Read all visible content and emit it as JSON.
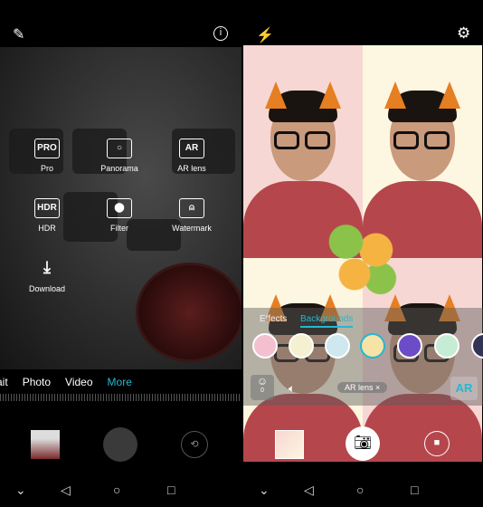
{
  "left": {
    "top_bar": {
      "edit_icon": "pencil-icon",
      "info_icon": "info-icon"
    },
    "modes": [
      {
        "label": "Pro",
        "icon": "PRO"
      },
      {
        "label": "Panorama",
        "icon": "panorama-icon"
      },
      {
        "label": "AR lens",
        "icon": "AR"
      },
      {
        "label": "HDR",
        "icon": "HDR"
      },
      {
        "label": "Filter",
        "icon": "filter-icon"
      },
      {
        "label": "Watermark",
        "icon": "watermark-icon"
      },
      {
        "label": "Download",
        "icon": "download-icon"
      }
    ],
    "tabs": [
      "ait",
      "Photo",
      "Video",
      "More"
    ],
    "active_tab": "More",
    "accent": "#22b8d4"
  },
  "right": {
    "top_bar": {
      "flash_icon": "flash-off-icon",
      "settings_icon": "gear-icon"
    },
    "effect_tabs": [
      "Effects",
      "Backgrounds"
    ],
    "active_effect_tab": "Backgrounds",
    "face_count": "0",
    "ar_chip": "AR lens",
    "ar_badge": "AR"
  },
  "nav": {
    "icons": [
      "chevron-down-icon",
      "back-icon",
      "home-icon",
      "recents-icon"
    ]
  }
}
